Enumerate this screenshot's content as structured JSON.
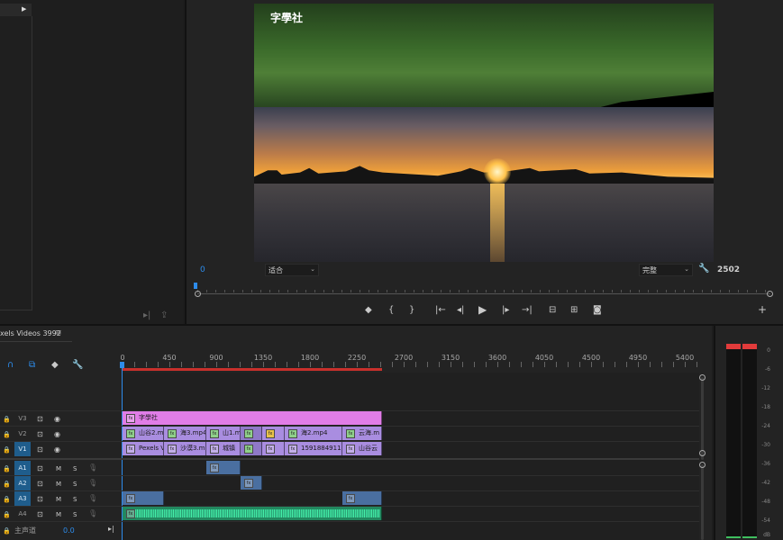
{
  "program": {
    "watermark": "字學社",
    "timecode_left": "0",
    "zoom_select": "适合",
    "quality_select": "完整",
    "timecode_right": "2502"
  },
  "timeline": {
    "sequence_title": "xels Videos 3992",
    "menu_icon": "≡",
    "ruler": [
      "0",
      "450",
      "900",
      "1350",
      "1800",
      "2250",
      "2700",
      "3150",
      "3600",
      "4050",
      "4500",
      "4950",
      "5400"
    ],
    "tracks": [
      {
        "name": "V3",
        "selected": false
      },
      {
        "name": "V2",
        "selected": false
      },
      {
        "name": "V1",
        "selected": true
      },
      {
        "name": "A1",
        "selected": true
      },
      {
        "name": "A2",
        "selected": true
      },
      {
        "name": "A3",
        "selected": true
      },
      {
        "name": "A4",
        "selected": false
      }
    ],
    "master_label": "主声道",
    "master_value": "0.0",
    "clips_v3": [
      {
        "label": "字學社"
      }
    ],
    "clips_v2": [
      {
        "label": "山谷2.mp4"
      },
      {
        "label": "海3.mp4"
      },
      {
        "label": "山1.m"
      },
      {
        "label": ""
      },
      {
        "label": ""
      },
      {
        "label": "海2.mp4"
      },
      {
        "label": "云海.m"
      }
    ],
    "clips_v1": [
      {
        "label": "Pexels Vid"
      },
      {
        "label": "沙漠3.mp4"
      },
      {
        "label": "城镇"
      },
      {
        "label": ""
      },
      {
        "label": ""
      },
      {
        "label": "1591884911125_"
      },
      {
        "label": "山谷云"
      }
    ]
  },
  "meter": {
    "scale": [
      "0",
      "-6",
      "-12",
      "-18",
      "-24",
      "-30",
      "-36",
      "-42",
      "-48",
      "-54"
    ],
    "unit": "dB"
  },
  "colors": {
    "accent_blue": "#2d8ceb",
    "video_clip": "#a98de0",
    "title_clip": "#e17de7",
    "audio_clip": "#4a6fa0",
    "audio_wave": "#34c48b"
  }
}
